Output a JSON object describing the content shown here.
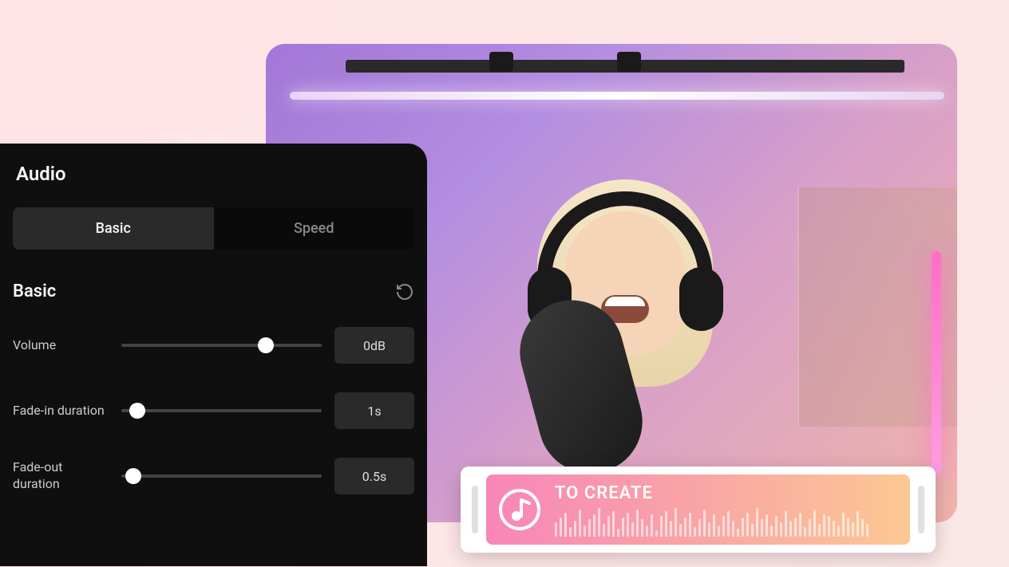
{
  "audioPanel": {
    "title": "Audio",
    "tabs": {
      "basic": "Basic",
      "speed": "Speed"
    },
    "section": {
      "title": "Basic"
    },
    "controls": {
      "volume": {
        "label": "Volume",
        "value": "0dB",
        "sliderPercent": 72
      },
      "fadeIn": {
        "label": "Fade-in duration",
        "value": "1s",
        "sliderPercent": 8
      },
      "fadeOut": {
        "label": "Fade-out duration",
        "value": "0.5s",
        "sliderPercent": 6
      }
    }
  },
  "audioClip": {
    "title": "TO CREATE",
    "iconName": "music-note-icon"
  },
  "waveformHeights": [
    18,
    24,
    30,
    12,
    20,
    34,
    14,
    22,
    28,
    36,
    16,
    26,
    32,
    10,
    24,
    30,
    18,
    34,
    22,
    14,
    28,
    8,
    26,
    32,
    20,
    36,
    16,
    24,
    30,
    12,
    22,
    34,
    18,
    28,
    14,
    26,
    32,
    20,
    10,
    24,
    30,
    16,
    36,
    22,
    28,
    14,
    26,
    18,
    32,
    20,
    24,
    30,
    12,
    22,
    34,
    16,
    28,
    26,
    20,
    14,
    30,
    24,
    18,
    32,
    22,
    16
  ]
}
